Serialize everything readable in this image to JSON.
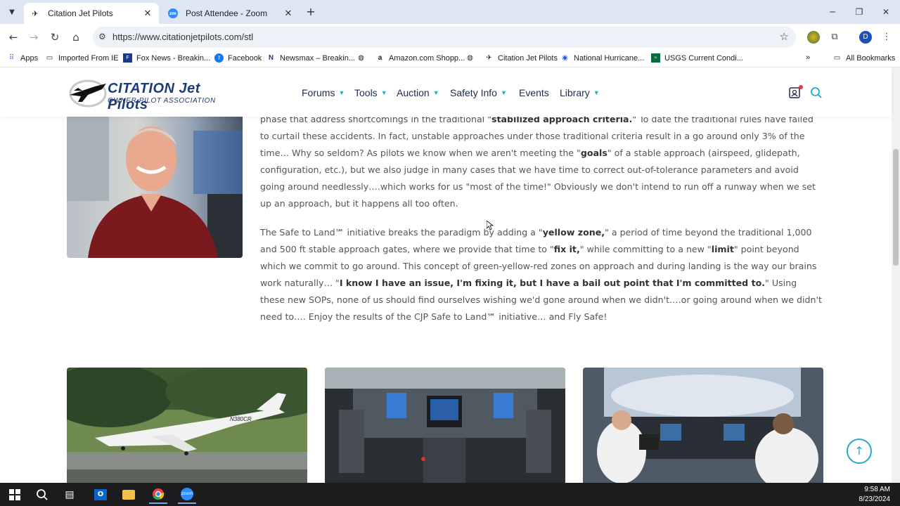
{
  "browser": {
    "tabs": [
      {
        "title": "Citation Jet Pilots",
        "active": true
      },
      {
        "title": "Post Attendee - Zoom",
        "active": false
      }
    ],
    "url": "https://www.citationjetpilots.com/stl",
    "profile_initial": "D"
  },
  "bookmarks": [
    {
      "label": "Apps",
      "icon": "apps-grid-icon"
    },
    {
      "label": "Imported From IE",
      "icon": "folder-icon"
    },
    {
      "label": "Fox News - Breakin...",
      "icon": "foxnews-icon"
    },
    {
      "label": "Facebook",
      "icon": "facebook-icon"
    },
    {
      "label": "Newsmax – Breakin...",
      "icon": "newsmax-icon"
    },
    {
      "label": "",
      "icon": "globe-icon"
    },
    {
      "label": "Amazon.com Shopp...",
      "icon": "amazon-icon"
    },
    {
      "label": "",
      "icon": "globe-icon"
    },
    {
      "label": "Citation Jet Pilots",
      "icon": "jet-icon"
    },
    {
      "label": "National Hurricane...",
      "icon": "nhc-icon"
    },
    {
      "label": "USGS Current Condi...",
      "icon": "usgs-icon"
    }
  ],
  "all_bookmarks": "All Bookmarks",
  "site": {
    "logo_line1": "CITATION Jet Pilots",
    "logo_line2": "OWNER PILOT ASSOCIATION",
    "menu": [
      "Forums",
      "Tools",
      "Auction",
      "Safety Info",
      "Events",
      "Library"
    ]
  },
  "article": {
    "p1_a": "phase that address shortcomings in the traditional \"",
    "p1_b": "stabilized approach criteria.",
    "p1_c": "\" To date the traditional rules have failed to curtail these accidents. In fact, unstable approaches under those traditional criteria result in a go around only 3% of the time… Why so seldom? As pilots we know when we aren't meeting the \"",
    "p1_d": "goals",
    "p1_e": "\" of a stable approach (airspeed, glidepath, configuration, etc.), but we also judge in many cases that we have time to correct out-of-tolerance parameters and avoid going around needlessly….which works for us \"most of the time!\" Obviously we don't intend to run off a runway when we set up an approach, but it happens all too often.",
    "p2_a": "The Safe to Land℠ initiative breaks the paradigm by adding a \"",
    "p2_b": "yellow zone,",
    "p2_c": "\" a period of time beyond the traditional 1,000 and 500 ft stable approach gates, where we provide that time to \"",
    "p2_d": "fix it,",
    "p2_e": "\" while committing to a new \"",
    "p2_f": "limit",
    "p2_g": "\" point beyond which we commit to go around. This concept of green-yellow-red zones on approach and during landing is the way our brains work naturally… \"",
    "p2_h": "I know I have an issue, I'm fixing it, but I have a bail out point that I'm committed to.",
    "p2_i": "\" Using these new SOPs, none of us should find ourselves wishing we'd gone around when we didn't….or going around when we didn't need to…. Enjoy the results of the CJP Safe to Land℠ initiative… and Fly Safe!"
  },
  "cards": [
    {
      "alt": "Citation jet landing",
      "tail": "N380CR"
    },
    {
      "alt": "Cockpit instrument panel"
    },
    {
      "alt": "Pilots in cockpit"
    }
  ],
  "taskbar": {
    "time": "9:58 AM",
    "date": "8/23/2024"
  }
}
